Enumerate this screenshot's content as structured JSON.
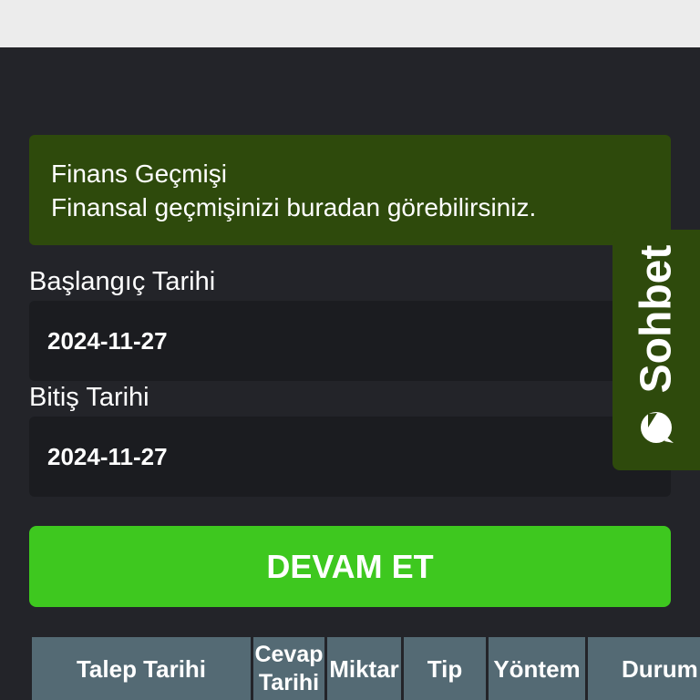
{
  "info": {
    "title": "Finans Geçmişi",
    "subtitle": "Finansal geçmişinizi buradan görebilirsiniz."
  },
  "form": {
    "start_label": "Başlangıç Tarihi",
    "start_value": "2024-11-27",
    "end_label": "Bitiş Tarihi",
    "end_value": "2024-11-27",
    "submit_label": "DEVAM ET"
  },
  "table": {
    "headers": [
      "Talep Tarihi",
      "Cevap Tarihi",
      "Miktar",
      "Tip",
      "Yöntem",
      "Durum"
    ]
  },
  "chat": {
    "label": "Sohbet",
    "icon": "chat-bubble-icon"
  },
  "colors": {
    "background": "#232429",
    "info_box": "#2e4a0c",
    "button": "#3ec81f",
    "table_header": "#546a74"
  }
}
